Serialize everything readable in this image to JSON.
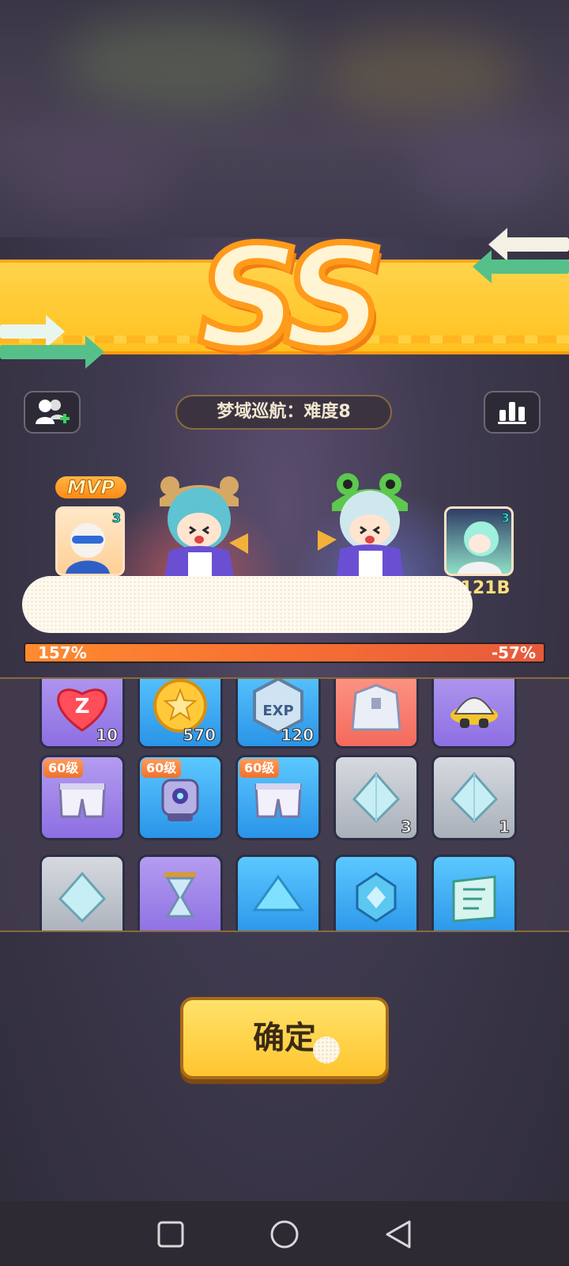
{
  "result": {
    "grade": "SS"
  },
  "header": {
    "stage_title": "梦域巡航：难度8",
    "left_icon": "add-friend-icon",
    "right_icon": "stats-icon"
  },
  "players": {
    "left": {
      "mvp_label": "MVP",
      "avatar_level": "3"
    },
    "right": {
      "avatar_level": "3",
      "score": "121B"
    }
  },
  "progress": {
    "left_label": "157%",
    "right_label": "-57%",
    "fill_fraction": 1.0
  },
  "rewards": [
    {
      "icon": "heart-icon",
      "count": "10",
      "theme": "purple"
    },
    {
      "icon": "coin-icon",
      "count": "570",
      "theme": "blue"
    },
    {
      "icon": "exp-icon",
      "count": "120",
      "theme": "blue"
    },
    {
      "icon": "jacket-icon",
      "count": "",
      "theme": "red"
    },
    {
      "icon": "hat-icon",
      "count": "",
      "theme": "purple"
    },
    {
      "icon": "shorts-icon",
      "count": "",
      "level": "60级",
      "theme": "purple"
    },
    {
      "icon": "device-icon",
      "count": "",
      "level": "60级",
      "theme": "blue"
    },
    {
      "icon": "shorts-icon",
      "count": "",
      "level": "60级",
      "theme": "blue"
    },
    {
      "icon": "crystal-icon",
      "count": "3",
      "theme": "gray"
    },
    {
      "icon": "crystal-icon",
      "count": "1",
      "theme": "gray"
    },
    {
      "icon": "crystal-icon",
      "count": "",
      "theme": "gray"
    },
    {
      "icon": "hourglass-icon",
      "count": "",
      "theme": "purple"
    },
    {
      "icon": "gem-icon",
      "count": "",
      "theme": "blue"
    },
    {
      "icon": "badge-icon",
      "count": "",
      "theme": "blue"
    },
    {
      "icon": "map-icon",
      "count": "",
      "theme": "blue"
    }
  ],
  "buttons": {
    "confirm_label": "确定"
  },
  "colors": {
    "banner": "#ffc21f",
    "bar": "#f46b34",
    "confirm": "#ffd03c"
  }
}
